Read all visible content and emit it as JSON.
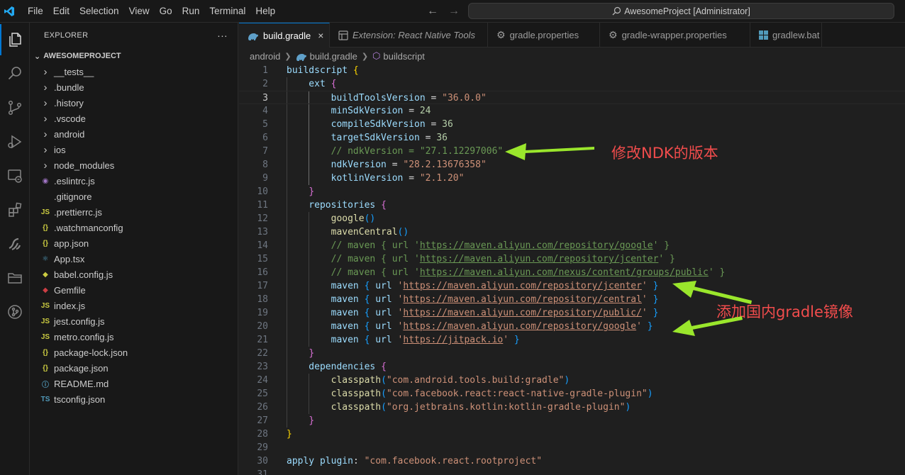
{
  "menu": [
    "File",
    "Edit",
    "Selection",
    "View",
    "Go",
    "Run",
    "Terminal",
    "Help"
  ],
  "command_center": "AwesomeProject [Administrator]",
  "sidebar": {
    "title": "EXPLORER",
    "more": "···",
    "section": "AWESOMEPROJECT",
    "items": [
      {
        "label": "__tests__",
        "type": "folder"
      },
      {
        "label": ".bundle",
        "type": "folder"
      },
      {
        "label": ".history",
        "type": "folder"
      },
      {
        "label": ".vscode",
        "type": "folder"
      },
      {
        "label": "android",
        "type": "folder"
      },
      {
        "label": "ios",
        "type": "folder"
      },
      {
        "label": "node_modules",
        "type": "folder"
      },
      {
        "label": ".eslintrc.js",
        "type": "file",
        "icon": "eslint-icon",
        "icon_text": "◉",
        "color": "#a074c4"
      },
      {
        "label": ".gitignore",
        "type": "file",
        "icon": "gitignore-icon",
        "icon_text": "",
        "color": "#9d9d9d"
      },
      {
        "label": ".prettierrc.js",
        "type": "file",
        "icon": "js-icon",
        "icon_text": "JS",
        "color": "#cbcb41"
      },
      {
        "label": ".watchmanconfig",
        "type": "file",
        "icon": "json-icon",
        "icon_text": "{}",
        "color": "#cbcb41"
      },
      {
        "label": "app.json",
        "type": "file",
        "icon": "json-icon",
        "icon_text": "{}",
        "color": "#cbcb41"
      },
      {
        "label": "App.tsx",
        "type": "file",
        "icon": "react-icon",
        "icon_text": "⚛",
        "color": "#519aba"
      },
      {
        "label": "babel.config.js",
        "type": "file",
        "icon": "babel-icon",
        "icon_text": "◆",
        "color": "#cbcb41"
      },
      {
        "label": "Gemfile",
        "type": "file",
        "icon": "ruby-icon",
        "icon_text": "◆",
        "color": "#cc3e44"
      },
      {
        "label": "index.js",
        "type": "file",
        "icon": "js-icon",
        "icon_text": "JS",
        "color": "#cbcb41"
      },
      {
        "label": "jest.config.js",
        "type": "file",
        "icon": "js-icon",
        "icon_text": "JS",
        "color": "#cbcb41"
      },
      {
        "label": "metro.config.js",
        "type": "file",
        "icon": "js-icon",
        "icon_text": "JS",
        "color": "#cbcb41"
      },
      {
        "label": "package-lock.json",
        "type": "file",
        "icon": "json-icon",
        "icon_text": "{}",
        "color": "#cbcb41"
      },
      {
        "label": "package.json",
        "type": "file",
        "icon": "json-icon",
        "icon_text": "{}",
        "color": "#cbcb41"
      },
      {
        "label": "README.md",
        "type": "file",
        "icon": "info-icon",
        "icon_text": "ⓘ",
        "color": "#519aba"
      },
      {
        "label": "tsconfig.json",
        "type": "file",
        "icon": "ts-icon",
        "icon_text": "TS",
        "color": "#519aba"
      }
    ]
  },
  "tabs": [
    {
      "label": "build.gradle",
      "active": true,
      "icon": "gradle-icon",
      "close": "×"
    },
    {
      "label": "Extension: React Native Tools",
      "active": false,
      "icon": "extension-icon"
    },
    {
      "label": "gradle.properties",
      "active": false,
      "icon": "gear-icon"
    },
    {
      "label": "gradle-wrapper.properties",
      "active": false,
      "icon": "gear-icon"
    },
    {
      "label": "gradlew.bat",
      "active": false,
      "icon": "windows-icon"
    }
  ],
  "breadcrumbs": [
    "android",
    "build.gradle",
    "buildscript"
  ],
  "editor": {
    "current_line": 3,
    "lines": [
      {
        "n": "1",
        "t": [
          [
            "buildscript ",
            "kw"
          ],
          [
            "{",
            "b1"
          ]
        ]
      },
      {
        "n": "2",
        "t": [
          [
            "    ext ",
            "kw"
          ],
          [
            "{",
            "b2"
          ]
        ]
      },
      {
        "n": "3",
        "t": [
          [
            "        buildToolsVersion ",
            "kw"
          ],
          [
            "= ",
            "op"
          ],
          [
            "\"36.0.0\"",
            "str"
          ]
        ]
      },
      {
        "n": "4",
        "t": [
          [
            "        minSdkVersion ",
            "kw"
          ],
          [
            "= ",
            "op"
          ],
          [
            "24",
            "num"
          ]
        ]
      },
      {
        "n": "5",
        "t": [
          [
            "        compileSdkVersion ",
            "kw"
          ],
          [
            "= ",
            "op"
          ],
          [
            "36",
            "num"
          ]
        ]
      },
      {
        "n": "6",
        "t": [
          [
            "        targetSdkVersion ",
            "kw"
          ],
          [
            "= ",
            "op"
          ],
          [
            "36",
            "num"
          ]
        ]
      },
      {
        "n": "7",
        "t": [
          [
            "        // ndkVersion = \"27.1.12297006\"",
            "cm"
          ]
        ]
      },
      {
        "n": "8",
        "t": [
          [
            "        ndkVersion ",
            "kw"
          ],
          [
            "= ",
            "op"
          ],
          [
            "\"28.2.13676358\"",
            "str"
          ]
        ]
      },
      {
        "n": "9",
        "t": [
          [
            "        kotlinVersion ",
            "kw"
          ],
          [
            "= ",
            "op"
          ],
          [
            "\"2.1.20\"",
            "str"
          ]
        ]
      },
      {
        "n": "10",
        "t": [
          [
            "    ",
            "op"
          ],
          [
            "}",
            "b2"
          ]
        ]
      },
      {
        "n": "11",
        "t": [
          [
            "    repositories ",
            "kw"
          ],
          [
            "{",
            "b2"
          ]
        ]
      },
      {
        "n": "12",
        "t": [
          [
            "        google",
            "fn"
          ],
          [
            "()",
            "b3"
          ]
        ]
      },
      {
        "n": "13",
        "t": [
          [
            "        mavenCentral",
            "fn"
          ],
          [
            "()",
            "b3"
          ]
        ]
      },
      {
        "n": "14",
        "t": [
          [
            "        // maven { url '",
            "cm"
          ],
          [
            "https://maven.aliyun.com/repository/google",
            "cm url"
          ],
          [
            "' }",
            "cm"
          ]
        ]
      },
      {
        "n": "15",
        "t": [
          [
            "        // maven { url '",
            "cm"
          ],
          [
            "https://maven.aliyun.com/repository/jcenter",
            "cm url"
          ],
          [
            "' }",
            "cm"
          ]
        ]
      },
      {
        "n": "16",
        "t": [
          [
            "        // maven { url '",
            "cm"
          ],
          [
            "https://maven.aliyun.com/nexus/content/groups/public",
            "cm url"
          ],
          [
            "' }",
            "cm"
          ]
        ]
      },
      {
        "n": "17",
        "t": [
          [
            "        maven ",
            "kw"
          ],
          [
            "{",
            "b3"
          ],
          [
            " url ",
            "kw"
          ],
          [
            "'",
            "str"
          ],
          [
            "https://maven.aliyun.com/repository/jcenter",
            "str url"
          ],
          [
            "' ",
            "str"
          ],
          [
            "}",
            "b3"
          ]
        ]
      },
      {
        "n": "18",
        "t": [
          [
            "        maven ",
            "kw"
          ],
          [
            "{",
            "b3"
          ],
          [
            " url ",
            "kw"
          ],
          [
            "'",
            "str"
          ],
          [
            "https://maven.aliyun.com/repository/central",
            "str url"
          ],
          [
            "' ",
            "str"
          ],
          [
            "}",
            "b3"
          ]
        ]
      },
      {
        "n": "19",
        "t": [
          [
            "        maven ",
            "kw"
          ],
          [
            "{",
            "b3"
          ],
          [
            " url ",
            "kw"
          ],
          [
            "'",
            "str"
          ],
          [
            "https://maven.aliyun.com/repository/public/",
            "str url"
          ],
          [
            "' ",
            "str"
          ],
          [
            "}",
            "b3"
          ]
        ]
      },
      {
        "n": "20",
        "t": [
          [
            "        maven ",
            "kw"
          ],
          [
            "{",
            "b3"
          ],
          [
            " url ",
            "kw"
          ],
          [
            "'",
            "str"
          ],
          [
            "https://maven.aliyun.com/repository/google",
            "str url"
          ],
          [
            "' ",
            "str"
          ],
          [
            "}",
            "b3"
          ]
        ]
      },
      {
        "n": "21",
        "t": [
          [
            "        maven ",
            "kw"
          ],
          [
            "{",
            "b3"
          ],
          [
            " url ",
            "kw"
          ],
          [
            "'",
            "str"
          ],
          [
            "https://jitpack.io",
            "str url"
          ],
          [
            "' ",
            "str"
          ],
          [
            "}",
            "b3"
          ]
        ]
      },
      {
        "n": "22",
        "t": [
          [
            "    ",
            "op"
          ],
          [
            "}",
            "b2"
          ]
        ]
      },
      {
        "n": "23",
        "t": [
          [
            "    dependencies ",
            "kw"
          ],
          [
            "{",
            "b2"
          ]
        ]
      },
      {
        "n": "24",
        "t": [
          [
            "        classpath",
            "fn"
          ],
          [
            "(",
            "b3"
          ],
          [
            "\"com.android.tools.build:gradle\"",
            "str"
          ],
          [
            ")",
            "b3"
          ]
        ]
      },
      {
        "n": "25",
        "t": [
          [
            "        classpath",
            "fn"
          ],
          [
            "(",
            "b3"
          ],
          [
            "\"com.facebook.react:react-native-gradle-plugin\"",
            "str"
          ],
          [
            ")",
            "b3"
          ]
        ]
      },
      {
        "n": "26",
        "t": [
          [
            "        classpath",
            "fn"
          ],
          [
            "(",
            "b3"
          ],
          [
            "\"org.jetbrains.kotlin:kotlin-gradle-plugin\"",
            "str"
          ],
          [
            ")",
            "b3"
          ]
        ]
      },
      {
        "n": "27",
        "t": [
          [
            "    ",
            "op"
          ],
          [
            "}",
            "b2"
          ]
        ]
      },
      {
        "n": "28",
        "t": [
          [
            "}",
            "b1"
          ]
        ]
      },
      {
        "n": "29",
        "t": []
      },
      {
        "n": "30",
        "t": [
          [
            "apply ",
            "kw"
          ],
          [
            "plugin",
            "kw"
          ],
          [
            ": ",
            "op"
          ],
          [
            "\"com.facebook.react.rootproject\"",
            "str"
          ]
        ]
      },
      {
        "n": "31",
        "t": []
      }
    ]
  },
  "annotations": {
    "ndk_note": "修改NDK的版本",
    "mirror_note": "添加国内gradle镜像",
    "color": "#f14c4c",
    "arrow_color": "#9ae62c"
  }
}
